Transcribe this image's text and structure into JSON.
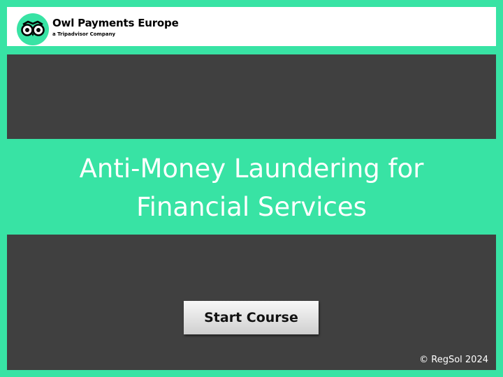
{
  "header": {
    "brand_name": "Owl Payments Europe",
    "brand_subtitle": "a Tripadvisor Company",
    "logo_icon": "owl-eyes-icon"
  },
  "main": {
    "title_line1": "Anti-Money Laundering for",
    "title_line2": "Financial Services",
    "start_button_label": "Start Course"
  },
  "footer": {
    "copyright": "© RegSol 2024"
  },
  "colors": {
    "background": "#38e3a4",
    "panel": "#404040",
    "header": "#ffffff",
    "text_light": "#ffffff"
  }
}
